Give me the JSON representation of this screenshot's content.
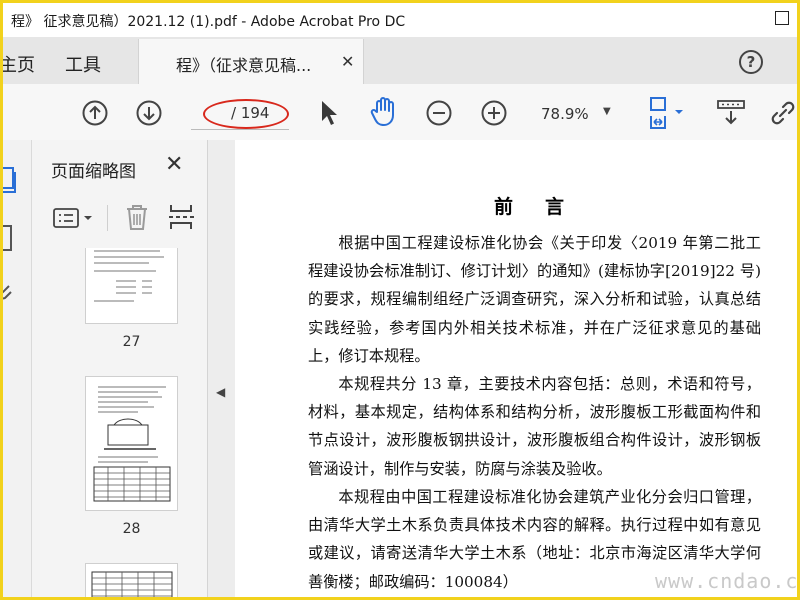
{
  "window": {
    "title": "程》 征求意见稿）2021.12 (1).pdf - Adobe Acrobat Pro DC"
  },
  "tabs": {
    "home_label": "主页",
    "tools_label": "工具",
    "document_tab_label": "程》（征求意见稿...",
    "close_glyph": "✕",
    "help_glyph": "?"
  },
  "toolbar": {
    "page_count": "/ 194",
    "zoom_value": "78.9%"
  },
  "thumbnails_panel": {
    "title": "页面缩略图",
    "close_glyph": "✕",
    "pages": [
      {
        "label": "27"
      },
      {
        "label": "28"
      }
    ]
  },
  "document": {
    "heading": "前言",
    "paragraphs": [
      "根据中国工程建设标准化协会《关于印发〈2019 年第二批工程建设协会标准制订、修订计划〉的通知》(建标协字[2019]22 号)的要求，规程编制组经广泛调查研究，深入分析和试验，认真总结实践经验，参考国内外相关技术标准，并在广泛征求意见的基础上，修订本规程。",
      "本规程共分 13 章，主要技术内容包括：总则，术语和符号，材料，基本规定，结构体系和结构分析，波形腹板工形截面构件和节点设计，波形腹板钢拱设计，波形腹板组合构件设计，波形钢板管涵设计，制作与安装，防腐与涂装及验收。",
      "本规程由中国工程建设标准化协会建筑产业化分会归口管理，由清华大学土木系负责具体技术内容的解释。执行过程中如有意见或建议，请寄送清华大学土木系（地址：北京市海淀区清华大学何善衡楼；邮政编码：100084）"
    ]
  },
  "watermark": {
    "text": "www.cndao.com"
  },
  "colors": {
    "frame_border": "#f2d21d",
    "accent_blue": "#2a6fd6",
    "annotation_red": "#d8281c"
  }
}
